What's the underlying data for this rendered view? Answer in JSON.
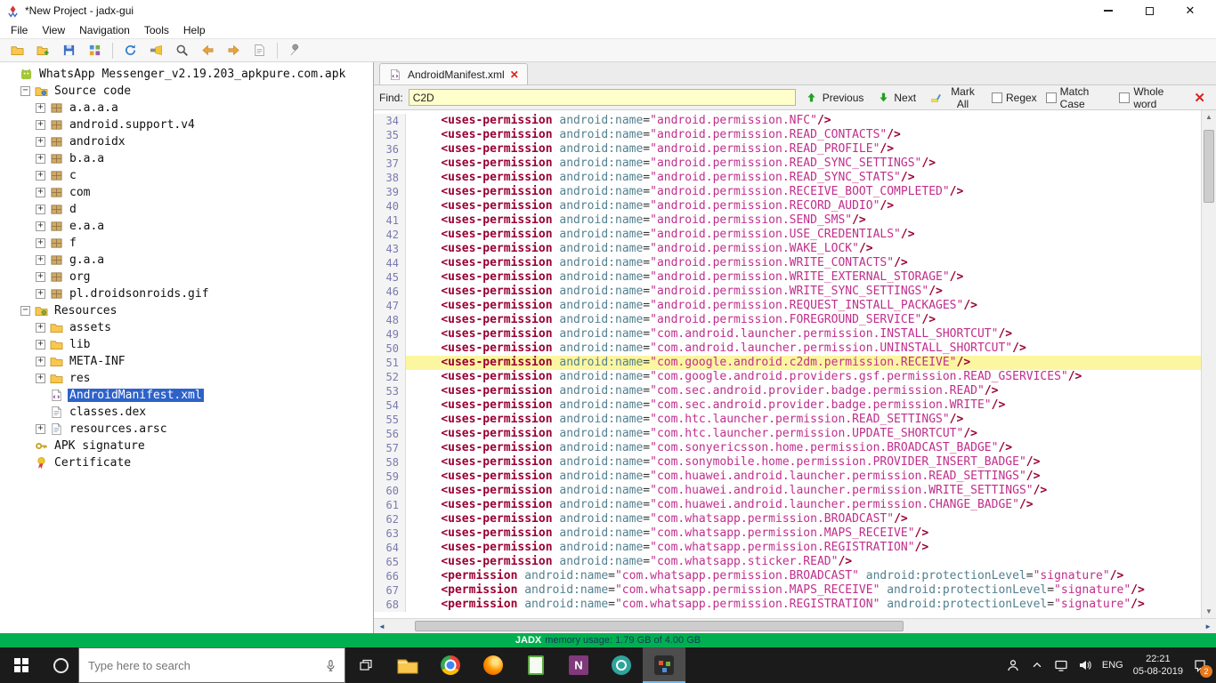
{
  "window": {
    "title": "*New Project - jadx-gui",
    "controls": [
      "minimize",
      "maximize",
      "close"
    ]
  },
  "menu": {
    "items": [
      "File",
      "View",
      "Navigation",
      "Tools",
      "Help"
    ]
  },
  "toolbar": {
    "icons": [
      "open-file",
      "add-files",
      "save-all",
      "export",
      "separator",
      "reload",
      "deobfuscation",
      "text-search",
      "back",
      "forward",
      "log-viewer",
      "separator",
      "preferences"
    ]
  },
  "colors": {
    "highlight_line": "#fdf6a0",
    "selection_blue": "#2e62c9",
    "status_green": "#00b050",
    "find_field_bg": "#ffffcc",
    "tag_color": "#990033",
    "attr_color": "#53808f",
    "string_color": "#c02e8c",
    "line_number_color": "#7a7ab0"
  },
  "tree": {
    "items": [
      {
        "label": "WhatsApp Messenger_v2.19.203_apkpure.com.apk",
        "depth": 0,
        "toggle": "none",
        "icon": "apk",
        "selected": false
      },
      {
        "label": "Source code",
        "depth": 1,
        "toggle": "minus",
        "icon": "source-folder",
        "selected": false
      },
      {
        "label": "a.a.a.a",
        "depth": 2,
        "toggle": "plus",
        "icon": "package",
        "selected": false
      },
      {
        "label": "android.support.v4",
        "depth": 2,
        "toggle": "plus",
        "icon": "package",
        "selected": false
      },
      {
        "label": "androidx",
        "depth": 2,
        "toggle": "plus",
        "icon": "package",
        "selected": false
      },
      {
        "label": "b.a.a",
        "depth": 2,
        "toggle": "plus",
        "icon": "package",
        "selected": false
      },
      {
        "label": "c",
        "depth": 2,
        "toggle": "plus",
        "icon": "package",
        "selected": false
      },
      {
        "label": "com",
        "depth": 2,
        "toggle": "plus",
        "icon": "package",
        "selected": false
      },
      {
        "label": "d",
        "depth": 2,
        "toggle": "plus",
        "icon": "package",
        "selected": false
      },
      {
        "label": "e.a.a",
        "depth": 2,
        "toggle": "plus",
        "icon": "package",
        "selected": false
      },
      {
        "label": "f",
        "depth": 2,
        "toggle": "plus",
        "icon": "package",
        "selected": false
      },
      {
        "label": "g.a.a",
        "depth": 2,
        "toggle": "plus",
        "icon": "package",
        "selected": false
      },
      {
        "label": "org",
        "depth": 2,
        "toggle": "plus",
        "icon": "package",
        "selected": false
      },
      {
        "label": "pl.droidsonroids.gif",
        "depth": 2,
        "toggle": "plus",
        "icon": "package",
        "selected": false
      },
      {
        "label": "Resources",
        "depth": 1,
        "toggle": "minus",
        "icon": "resources-folder",
        "selected": false
      },
      {
        "label": "assets",
        "depth": 2,
        "toggle": "plus",
        "icon": "folder",
        "selected": false
      },
      {
        "label": "lib",
        "depth": 2,
        "toggle": "plus",
        "icon": "folder",
        "selected": false
      },
      {
        "label": "META-INF",
        "depth": 2,
        "toggle": "plus",
        "icon": "folder",
        "selected": false
      },
      {
        "label": "res",
        "depth": 2,
        "toggle": "plus",
        "icon": "folder",
        "selected": false
      },
      {
        "label": "AndroidManifest.xml",
        "depth": 2,
        "toggle": "none",
        "icon": "xml-file",
        "selected": true
      },
      {
        "label": "classes.dex",
        "depth": 2,
        "toggle": "none",
        "icon": "file",
        "selected": false
      },
      {
        "label": "resources.arsc",
        "depth": 2,
        "toggle": "plus",
        "icon": "file",
        "selected": false
      },
      {
        "label": "APK signature",
        "depth": 1,
        "toggle": "none",
        "icon": "key",
        "selected": false
      },
      {
        "label": "Certificate",
        "depth": 1,
        "toggle": "none",
        "icon": "certificate",
        "selected": false
      }
    ]
  },
  "editor": {
    "tab": {
      "label": "AndroidManifest.xml"
    },
    "find": {
      "label": "Find:",
      "value": "C2D",
      "previous": "Previous",
      "next": "Next",
      "mark_all": "Mark All",
      "regex": "Regex",
      "match_case": "Match Case",
      "whole_word": "Whole word"
    },
    "lines": [
      {
        "n": 34,
        "tag": "uses-permission",
        "attrs": [
          [
            "android:name",
            "android.permission.NFC"
          ]
        ],
        "highlight": false
      },
      {
        "n": 35,
        "tag": "uses-permission",
        "attrs": [
          [
            "android:name",
            "android.permission.READ_CONTACTS"
          ]
        ],
        "highlight": false
      },
      {
        "n": 36,
        "tag": "uses-permission",
        "attrs": [
          [
            "android:name",
            "android.permission.READ_PROFILE"
          ]
        ],
        "highlight": false
      },
      {
        "n": 37,
        "tag": "uses-permission",
        "attrs": [
          [
            "android:name",
            "android.permission.READ_SYNC_SETTINGS"
          ]
        ],
        "highlight": false
      },
      {
        "n": 38,
        "tag": "uses-permission",
        "attrs": [
          [
            "android:name",
            "android.permission.READ_SYNC_STATS"
          ]
        ],
        "highlight": false
      },
      {
        "n": 39,
        "tag": "uses-permission",
        "attrs": [
          [
            "android:name",
            "android.permission.RECEIVE_BOOT_COMPLETED"
          ]
        ],
        "highlight": false
      },
      {
        "n": 40,
        "tag": "uses-permission",
        "attrs": [
          [
            "android:name",
            "android.permission.RECORD_AUDIO"
          ]
        ],
        "highlight": false
      },
      {
        "n": 41,
        "tag": "uses-permission",
        "attrs": [
          [
            "android:name",
            "android.permission.SEND_SMS"
          ]
        ],
        "highlight": false
      },
      {
        "n": 42,
        "tag": "uses-permission",
        "attrs": [
          [
            "android:name",
            "android.permission.USE_CREDENTIALS"
          ]
        ],
        "highlight": false
      },
      {
        "n": 43,
        "tag": "uses-permission",
        "attrs": [
          [
            "android:name",
            "android.permission.WAKE_LOCK"
          ]
        ],
        "highlight": false
      },
      {
        "n": 44,
        "tag": "uses-permission",
        "attrs": [
          [
            "android:name",
            "android.permission.WRITE_CONTACTS"
          ]
        ],
        "highlight": false
      },
      {
        "n": 45,
        "tag": "uses-permission",
        "attrs": [
          [
            "android:name",
            "android.permission.WRITE_EXTERNAL_STORAGE"
          ]
        ],
        "highlight": false
      },
      {
        "n": 46,
        "tag": "uses-permission",
        "attrs": [
          [
            "android:name",
            "android.permission.WRITE_SYNC_SETTINGS"
          ]
        ],
        "highlight": false
      },
      {
        "n": 47,
        "tag": "uses-permission",
        "attrs": [
          [
            "android:name",
            "android.permission.REQUEST_INSTALL_PACKAGES"
          ]
        ],
        "highlight": false
      },
      {
        "n": 48,
        "tag": "uses-permission",
        "attrs": [
          [
            "android:name",
            "android.permission.FOREGROUND_SERVICE"
          ]
        ],
        "highlight": false
      },
      {
        "n": 49,
        "tag": "uses-permission",
        "attrs": [
          [
            "android:name",
            "com.android.launcher.permission.INSTALL_SHORTCUT"
          ]
        ],
        "highlight": false
      },
      {
        "n": 50,
        "tag": "uses-permission",
        "attrs": [
          [
            "android:name",
            "com.android.launcher.permission.UNINSTALL_SHORTCUT"
          ]
        ],
        "highlight": false
      },
      {
        "n": 51,
        "tag": "uses-permission",
        "attrs": [
          [
            "android:name",
            "com.google.android.c2dm.permission.RECEIVE"
          ]
        ],
        "highlight": true
      },
      {
        "n": 52,
        "tag": "uses-permission",
        "attrs": [
          [
            "android:name",
            "com.google.android.providers.gsf.permission.READ_GSERVICES"
          ]
        ],
        "highlight": false
      },
      {
        "n": 53,
        "tag": "uses-permission",
        "attrs": [
          [
            "android:name",
            "com.sec.android.provider.badge.permission.READ"
          ]
        ],
        "highlight": false
      },
      {
        "n": 54,
        "tag": "uses-permission",
        "attrs": [
          [
            "android:name",
            "com.sec.android.provider.badge.permission.WRITE"
          ]
        ],
        "highlight": false
      },
      {
        "n": 55,
        "tag": "uses-permission",
        "attrs": [
          [
            "android:name",
            "com.htc.launcher.permission.READ_SETTINGS"
          ]
        ],
        "highlight": false
      },
      {
        "n": 56,
        "tag": "uses-permission",
        "attrs": [
          [
            "android:name",
            "com.htc.launcher.permission.UPDATE_SHORTCUT"
          ]
        ],
        "highlight": false
      },
      {
        "n": 57,
        "tag": "uses-permission",
        "attrs": [
          [
            "android:name",
            "com.sonyericsson.home.permission.BROADCAST_BADGE"
          ]
        ],
        "highlight": false
      },
      {
        "n": 58,
        "tag": "uses-permission",
        "attrs": [
          [
            "android:name",
            "com.sonymobile.home.permission.PROVIDER_INSERT_BADGE"
          ]
        ],
        "highlight": false
      },
      {
        "n": 59,
        "tag": "uses-permission",
        "attrs": [
          [
            "android:name",
            "com.huawei.android.launcher.permission.READ_SETTINGS"
          ]
        ],
        "highlight": false
      },
      {
        "n": 60,
        "tag": "uses-permission",
        "attrs": [
          [
            "android:name",
            "com.huawei.android.launcher.permission.WRITE_SETTINGS"
          ]
        ],
        "highlight": false
      },
      {
        "n": 61,
        "tag": "uses-permission",
        "attrs": [
          [
            "android:name",
            "com.huawei.android.launcher.permission.CHANGE_BADGE"
          ]
        ],
        "highlight": false
      },
      {
        "n": 62,
        "tag": "uses-permission",
        "attrs": [
          [
            "android:name",
            "com.whatsapp.permission.BROADCAST"
          ]
        ],
        "highlight": false
      },
      {
        "n": 63,
        "tag": "uses-permission",
        "attrs": [
          [
            "android:name",
            "com.whatsapp.permission.MAPS_RECEIVE"
          ]
        ],
        "highlight": false
      },
      {
        "n": 64,
        "tag": "uses-permission",
        "attrs": [
          [
            "android:name",
            "com.whatsapp.permission.REGISTRATION"
          ]
        ],
        "highlight": false
      },
      {
        "n": 65,
        "tag": "uses-permission",
        "attrs": [
          [
            "android:name",
            "com.whatsapp.sticker.READ"
          ]
        ],
        "highlight": false
      },
      {
        "n": 66,
        "tag": "permission",
        "attrs": [
          [
            "android:name",
            "com.whatsapp.permission.BROADCAST"
          ],
          [
            "android:protectionLevel",
            "signature"
          ]
        ],
        "highlight": false
      },
      {
        "n": 67,
        "tag": "permission",
        "attrs": [
          [
            "android:name",
            "com.whatsapp.permission.MAPS_RECEIVE"
          ],
          [
            "android:protectionLevel",
            "signature"
          ]
        ],
        "highlight": false
      },
      {
        "n": 68,
        "tag": "permission",
        "attrs": [
          [
            "android:name",
            "com.whatsapp.permission.REGISTRATION"
          ],
          [
            "android:protectionLevel",
            "signature"
          ]
        ],
        "highlight": false
      }
    ]
  },
  "status": {
    "app": "JADX",
    "memory": "memory usage: 1.79 GB of 4.00 GB"
  },
  "taskbar": {
    "search_placeholder": "Type here to search",
    "apps": [
      "file-explorer",
      "chrome",
      "firefox",
      "notepad",
      "onenote",
      "apk-tool",
      "jadx"
    ],
    "active_app": "jadx",
    "tray": {
      "language": "ENG",
      "time": "22:21",
      "date": "05-08-2019",
      "badge": "2"
    }
  }
}
